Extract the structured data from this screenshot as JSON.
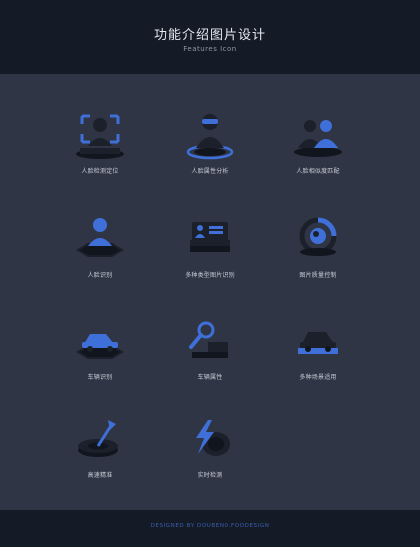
{
  "header": {
    "title": "功能介绍图片设计",
    "subtitle": "Features Icon"
  },
  "colors": {
    "accent": "#3f6fd8",
    "dark": "#1b202b",
    "base": "#11151d"
  },
  "icons": [
    {
      "name": "face-detection-icon",
      "label": "人脸检测定位"
    },
    {
      "name": "face-attribute-icon",
      "label": "人脸属性分析"
    },
    {
      "name": "face-compare-icon",
      "label": "人脸相似度匹配"
    },
    {
      "name": "face-recognition-icon",
      "label": "人脸识别"
    },
    {
      "name": "card-recognition-icon",
      "label": "多种类型图片识别"
    },
    {
      "name": "image-quality-icon",
      "label": "图片质量控制"
    },
    {
      "name": "vehicle-recognition-icon",
      "label": "车辆识别"
    },
    {
      "name": "vehicle-attribute-icon",
      "label": "车辆属性"
    },
    {
      "name": "scene-adapt-icon",
      "label": "多种场景适用"
    },
    {
      "name": "high-precision-icon",
      "label": "高速精准"
    },
    {
      "name": "realtime-detect-icon",
      "label": "实时检测"
    }
  ],
  "footer": {
    "credit": "DESIGNED BY DOUBEN0.FOODESIGN"
  }
}
